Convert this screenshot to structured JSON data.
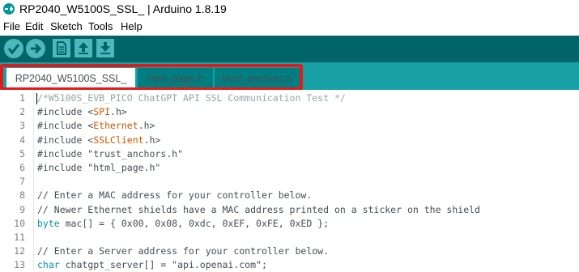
{
  "window": {
    "title": "RP2040_W5100S_SSL_ | Arduino 1.8.19"
  },
  "menu": [
    "File",
    "Edit",
    "Sketch",
    "Tools",
    "Help"
  ],
  "toolbar": {
    "buttons": [
      {
        "name": "verify",
        "icon": "check-icon"
      },
      {
        "name": "upload",
        "icon": "arrow-right-icon"
      },
      {
        "name": "new",
        "icon": "file-icon"
      },
      {
        "name": "open",
        "icon": "arrow-up-icon"
      },
      {
        "name": "save",
        "icon": "arrow-down-icon"
      }
    ]
  },
  "tabs": [
    {
      "label": "RP2040_W5100S_SSL_",
      "active": true
    },
    {
      "label": "html_page.h",
      "active": false
    },
    {
      "label": "trust_anchors.h",
      "active": false
    }
  ],
  "colors": {
    "titlebar": "#ffffff",
    "toolbar": "#006468",
    "tabbar": "#17a1a5",
    "tab_inactive": "#007e82",
    "highlight": "#e41a1a",
    "keyword": "#00979c",
    "library": "#d35400",
    "comment": "#95a5a6"
  },
  "editor": {
    "line_numbers": [
      "1",
      "2",
      "3",
      "4",
      "5",
      "6",
      "7",
      "8",
      "9",
      "10",
      "11",
      "12",
      "13"
    ],
    "lines": [
      {
        "parts": [
          {
            "t": "/*W5100S_EVB_PICO ChatGPT API SSL Communication Test */",
            "c": "comment"
          }
        ]
      },
      {
        "parts": [
          {
            "t": "#include <",
            "c": ""
          },
          {
            "t": "SPI",
            "c": "lib"
          },
          {
            "t": ".h>",
            "c": ""
          }
        ]
      },
      {
        "parts": [
          {
            "t": "#include <",
            "c": ""
          },
          {
            "t": "Ethernet",
            "c": "lib"
          },
          {
            "t": ".h>",
            "c": ""
          }
        ]
      },
      {
        "parts": [
          {
            "t": "#include <",
            "c": ""
          },
          {
            "t": "SSLClient",
            "c": "lib"
          },
          {
            "t": ".h>",
            "c": ""
          }
        ]
      },
      {
        "parts": [
          {
            "t": "#include \"trust_anchors.h\"",
            "c": ""
          }
        ]
      },
      {
        "parts": [
          {
            "t": "#include \"html_page.h\"",
            "c": ""
          }
        ]
      },
      {
        "parts": [
          {
            "t": "",
            "c": ""
          }
        ]
      },
      {
        "parts": [
          {
            "t": "// Enter a MAC address for your controller below.",
            "c": ""
          }
        ]
      },
      {
        "parts": [
          {
            "t": "// Newer Ethernet shields have a MAC address printed on a sticker on the shield",
            "c": ""
          }
        ]
      },
      {
        "parts": [
          {
            "t": "byte",
            "c": "kw"
          },
          {
            "t": " mac[] = { 0x00, 0x08, 0xdc, 0xEF, 0xFE, 0xED };",
            "c": ""
          }
        ]
      },
      {
        "parts": [
          {
            "t": "",
            "c": ""
          }
        ]
      },
      {
        "parts": [
          {
            "t": "// Enter a Server address for your controller below.",
            "c": ""
          }
        ]
      },
      {
        "parts": [
          {
            "t": "char",
            "c": "kw"
          },
          {
            "t": " chatgpt_server[] = \"api.openai.com\";",
            "c": ""
          }
        ]
      }
    ]
  }
}
